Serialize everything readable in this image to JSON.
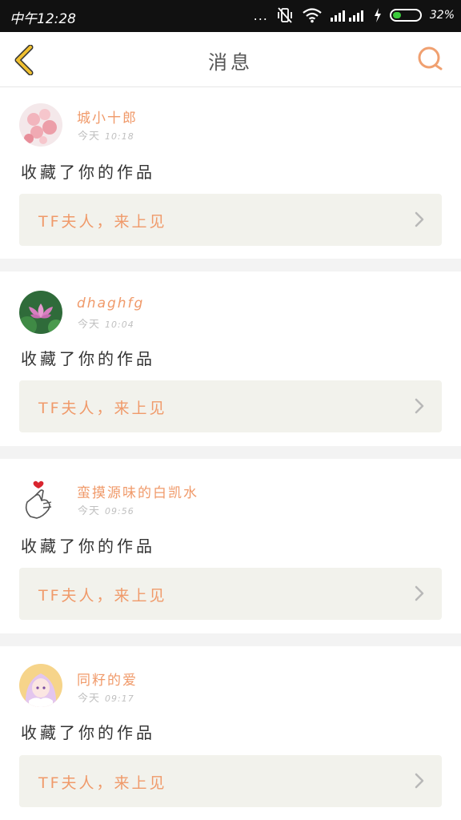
{
  "status_bar": {
    "time": "中午12:28",
    "dots": "...",
    "battery_percent": "32%",
    "battery_level": 0.32,
    "battery_color": "#3ccb3c"
  },
  "header": {
    "title": "消息",
    "back_icon": "chevron-left-icon",
    "search_icon": "search-icon",
    "accent_back": "#f0c030",
    "accent_search": "#f0a070"
  },
  "colors": {
    "name": "#f09a6a",
    "work_title": "#f09a6a",
    "work_bg": "#f2f2ec"
  },
  "messages": [
    {
      "username": "城小十郎",
      "day": "今天",
      "time": "10:18",
      "action": "收藏了你的作品",
      "work_title": "TF夫人，来上见",
      "avatar": "pink-bubbles-avatar"
    },
    {
      "username": "dhaghfg",
      "day": "今天",
      "time": "10:04",
      "action": "收藏了你的作品",
      "work_title": "TF夫人，来上见",
      "avatar": "lotus-avatar"
    },
    {
      "username": "蛮摸源味的白凯水",
      "day": "今天",
      "time": "09:56",
      "action": "收藏了你的作品",
      "work_title": "TF夫人，来上见",
      "avatar": "finger-heart-avatar"
    },
    {
      "username": "同籽的爱",
      "day": "今天",
      "time": "09:17",
      "action": "收藏了你的作品",
      "work_title": "TF夫人，来上见",
      "avatar": "anime-girl-avatar"
    }
  ]
}
